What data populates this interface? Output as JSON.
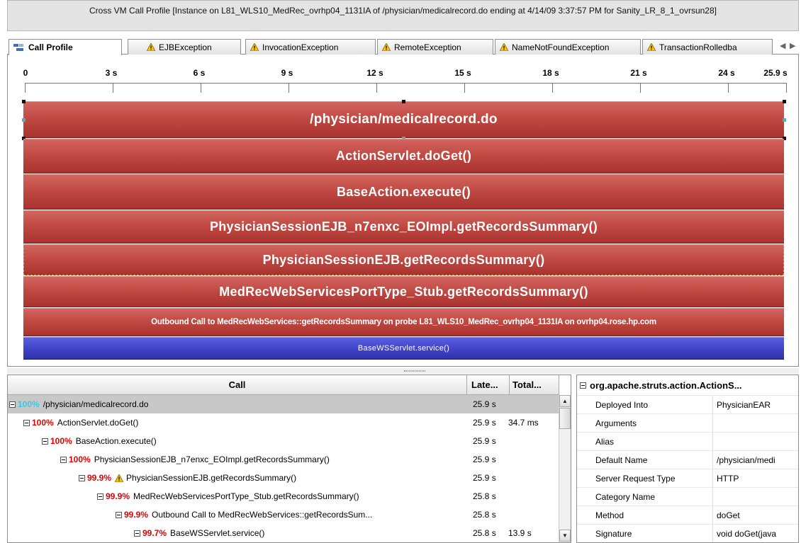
{
  "window": {
    "title": "Cross VM Call Profile [Instance on L81_WLS10_MedRec_ovrhp04_1131IA of /physician/medicalrecord.do ending at 4/14/09 3:37:57 PM for Sanity_LR_8_1_ovrsun28]"
  },
  "tabs": [
    {
      "label": "Call Profile",
      "icon": "call-profile-icon"
    },
    {
      "label": "EJBException",
      "icon": "warning-icon"
    },
    {
      "label": "InvocationException",
      "icon": "warning-icon"
    },
    {
      "label": "RemoteException",
      "icon": "warning-icon"
    },
    {
      "label": "NameNotFoundException",
      "icon": "warning-icon"
    },
    {
      "label": "TransactionRolledba",
      "icon": "warning-icon"
    }
  ],
  "timeline": {
    "ticks": [
      "0",
      "3 s",
      "6 s",
      "9 s",
      "12 s",
      "15 s",
      "18 s",
      "21 s",
      "24 s",
      "25.9 s"
    ],
    "bars": [
      {
        "label": "/physician/medicalrecord.do",
        "color": "red"
      },
      {
        "label": "ActionServlet.doGet()",
        "color": "red"
      },
      {
        "label": "BaseAction.execute()",
        "color": "red"
      },
      {
        "label": "PhysicianSessionEJB_n7enxc_EOImpl.getRecordsSummary()",
        "color": "red"
      },
      {
        "label": "PhysicianSessionEJB.getRecordsSummary()",
        "color": "red"
      },
      {
        "label": "MedRecWebServicesPortType_Stub.getRecordsSummary()",
        "color": "red"
      },
      {
        "label": "Outbound Call to MedRecWebServices::getRecordsSummary on probe L81_WLS10_MedRec_ovrhp04_1131IA on ovrhp04.rose.hp.com",
        "color": "red"
      },
      {
        "label": "BaseWSServlet.service()",
        "color": "blue"
      }
    ]
  },
  "call_tree": {
    "columns": {
      "call": "Call",
      "latency": "Late...",
      "total": "Total..."
    },
    "rows": [
      {
        "pct": "100%",
        "name": "/physician/medicalrecord.do",
        "latency": "25.9 s",
        "total": ""
      },
      {
        "pct": "100%",
        "name": "ActionServlet.doGet()",
        "latency": "25.9 s",
        "total": "34.7 ms"
      },
      {
        "pct": "100%",
        "name": "BaseAction.execute()",
        "latency": "25.9 s",
        "total": ""
      },
      {
        "pct": "100%",
        "name": "PhysicianSessionEJB_n7enxc_EOImpl.getRecordsSummary()",
        "latency": "25.9 s",
        "total": ""
      },
      {
        "pct": "99.9%",
        "name": "PhysicianSessionEJB.getRecordsSummary()",
        "latency": "25.9 s",
        "total": ""
      },
      {
        "pct": "99.9%",
        "name": "MedRecWebServicesPortType_Stub.getRecordsSummary()",
        "latency": "25.8 s",
        "total": ""
      },
      {
        "pct": "99.9%",
        "name": "Outbound Call to MedRecWebServices::getRecordsSum...",
        "latency": "25.8 s",
        "total": ""
      },
      {
        "pct": "99.7%",
        "name": "BaseWSServlet.service()",
        "latency": "25.8 s",
        "total": "13.9 s"
      }
    ]
  },
  "properties": {
    "header": "org.apache.struts.action.ActionS...",
    "rows": [
      {
        "key": "Deployed Into",
        "value": "PhysicianEAR"
      },
      {
        "key": "Arguments",
        "value": ""
      },
      {
        "key": "Alias",
        "value": ""
      },
      {
        "key": "Default Name",
        "value": "/physician/medi"
      },
      {
        "key": "Server Request Type",
        "value": "HTTP"
      },
      {
        "key": "Category Name",
        "value": ""
      },
      {
        "key": "Method",
        "value": "doGet"
      },
      {
        "key": "Signature",
        "value": "void doGet(java"
      }
    ]
  },
  "colors": {
    "bar_red": "#c24a44",
    "bar_blue": "#3d40c4",
    "percent_red": "#e00000",
    "percent_cyan": "#37c9e2",
    "warning_yellow": "#f0c419"
  }
}
